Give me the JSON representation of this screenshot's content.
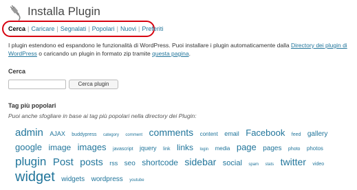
{
  "header": {
    "title": "Installa Plugin"
  },
  "subnav": [
    {
      "label": "Cerca",
      "current": true
    },
    {
      "label": "Caricare"
    },
    {
      "label": "Segnalati"
    },
    {
      "label": "Popolari"
    },
    {
      "label": "Nuovi"
    },
    {
      "label": "Preferiti"
    }
  ],
  "colors": {
    "accent": "#21759b",
    "highlight": "#d6000f"
  },
  "intro": {
    "text1": "I plugin estendono ed espandono le funzionalità di WordPress. Puoi installare i plugin automaticamente dalla ",
    "link1": "Directory dei plugin di WordPress",
    "text2": " o caricando un plugin in formato zip tramite ",
    "link2": "questa pagina",
    "text3": "."
  },
  "search": {
    "title": "Cerca",
    "value": "",
    "button_label": "Cerca plugin"
  },
  "tags": {
    "title": "Tag più popolari",
    "description": "Puoi anche sfogliare in base ai tag più popolari nella directory dei Plugin:",
    "items": [
      {
        "label": "admin",
        "size": 15
      },
      {
        "label": "AJAX",
        "size": 9
      },
      {
        "label": "buddypress",
        "size": 7
      },
      {
        "label": "category",
        "size": 6
      },
      {
        "label": "comment",
        "size": 6
      },
      {
        "label": "comments",
        "size": 14
      },
      {
        "label": "content",
        "size": 8
      },
      {
        "label": "email",
        "size": 9
      },
      {
        "label": "Facebook",
        "size": 13
      },
      {
        "label": "feed",
        "size": 7
      },
      {
        "label": "gallery",
        "size": 10
      },
      {
        "label": "google",
        "size": 13
      },
      {
        "label": "image",
        "size": 12
      },
      {
        "label": "images",
        "size": 13
      },
      {
        "label": "javascript",
        "size": 7
      },
      {
        "label": "jquery",
        "size": 9
      },
      {
        "label": "link",
        "size": 7
      },
      {
        "label": "links",
        "size": 12
      },
      {
        "label": "login",
        "size": 6
      },
      {
        "label": "media",
        "size": 8
      },
      {
        "label": "page",
        "size": 13
      },
      {
        "label": "pages",
        "size": 10
      },
      {
        "label": "photo",
        "size": 7
      },
      {
        "label": "photos",
        "size": 8
      },
      {
        "label": "plugin",
        "size": 17
      },
      {
        "label": "Post",
        "size": 15
      },
      {
        "label": "posts",
        "size": 14
      },
      {
        "label": "rss",
        "size": 9
      },
      {
        "label": "seo",
        "size": 10
      },
      {
        "label": "shortcode",
        "size": 12
      },
      {
        "label": "sidebar",
        "size": 14
      },
      {
        "label": "social",
        "size": 11
      },
      {
        "label": "spam",
        "size": 6
      },
      {
        "label": "stats",
        "size": 6
      },
      {
        "label": "twitter",
        "size": 14
      },
      {
        "label": "video",
        "size": 7
      },
      {
        "label": "widget",
        "size": 20
      },
      {
        "label": "widgets",
        "size": 10
      },
      {
        "label": "wordpress",
        "size": 10
      },
      {
        "label": "youtube",
        "size": 6
      }
    ]
  }
}
